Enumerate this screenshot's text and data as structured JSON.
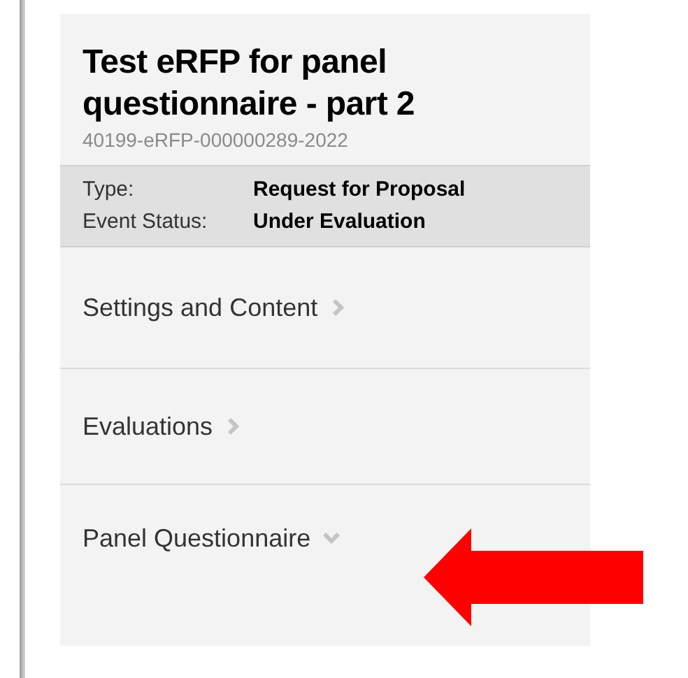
{
  "event": {
    "title": "Test eRFP for panel questionnaire - part 2",
    "id": "40199-eRFP-000000289-2022"
  },
  "details": [
    {
      "label": "Type:",
      "value": "Request for Proposal"
    },
    {
      "label": "Event Status:",
      "value": "Under Evaluation"
    }
  ],
  "menu": [
    {
      "label": "Settings and Content",
      "expanded": false
    },
    {
      "label": "Evaluations",
      "expanded": false
    },
    {
      "label": "Panel Questionnaire",
      "expanded": true
    }
  ]
}
